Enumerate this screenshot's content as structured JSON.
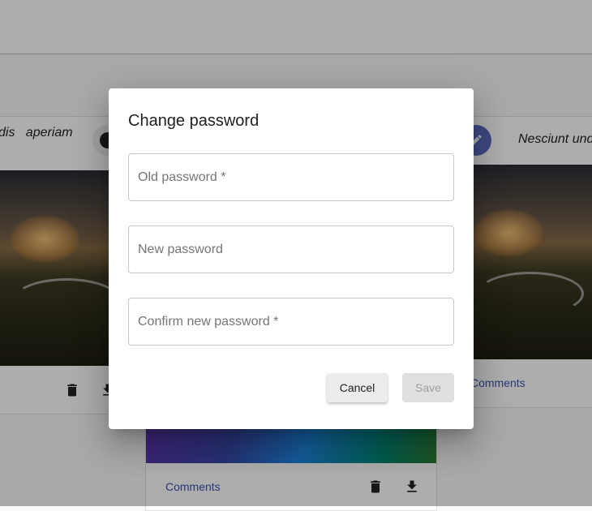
{
  "background": {
    "left_card_caption": "dis   aperiam",
    "right_card_caption": "Nesciunt unde",
    "right_card_comments": "Comments",
    "bottom_card_comments": "Comments"
  },
  "dialog": {
    "title": "Change password",
    "old_password_placeholder": "Old password *",
    "new_password_placeholder": "New password",
    "confirm_password_placeholder": "Confirm new password *",
    "cancel_label": "Cancel",
    "save_label": "Save"
  },
  "colors": {
    "overlay": "rgba(0,0,0,0.32)",
    "link": "#3f51b5",
    "accent_chip": "#5c6bc0"
  }
}
